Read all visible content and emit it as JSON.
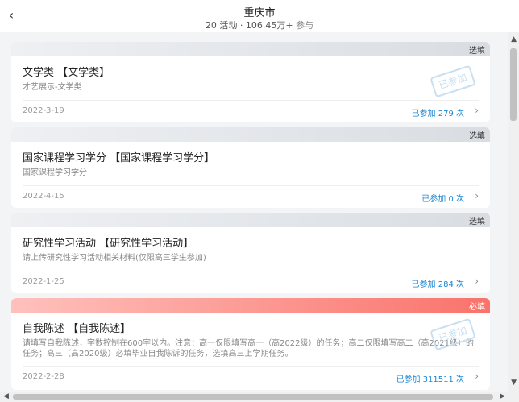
{
  "header": {
    "back_icon": "‹",
    "title": "重庆市",
    "activities": "20 活动",
    "separator": " · ",
    "participants": "106.45万+",
    "participants_suffix": " 参与"
  },
  "cards": [
    {
      "tag": "选填",
      "title": "文学类 【文学类】",
      "desc": "才艺展示-文学类",
      "date": "2022-3-19",
      "joined": "已参加 279 次",
      "stamp": "已参加",
      "required": false
    },
    {
      "tag": "选填",
      "title": "国家课程学习学分 【国家课程学习学分】",
      "desc": "国家课程学习学分",
      "date": "2022-4-15",
      "joined": "已参加 0 次",
      "required": false
    },
    {
      "tag": "选填",
      "title": "研究性学习活动 【研究性学习活动】",
      "desc": "请上传研究性学习活动相关材料(仅限高三学生参加)",
      "date": "2022-1-25",
      "joined": "已参加 284 次",
      "required": false
    },
    {
      "tag": "必填",
      "title": "自我陈述 【自我陈述】",
      "desc": "请填写自我陈述，字数控制在600字以内。注意：高一仅限填写高一（高2022级）的任务；高二仅限填写高二（高2021级）的任务；高三（高2020级）必填毕业自我陈诉的任务，选填高三上学期任务。",
      "date": "2022-2-28",
      "joined": "已参加 311511 次",
      "stamp": "已参加",
      "required": true
    }
  ],
  "icons": {
    "chevron_right": "›",
    "scroll_up": "▲",
    "scroll_down": "▼",
    "scroll_left": "◀",
    "scroll_right": "▶"
  },
  "colors": {
    "joined_text": "#1c86d1",
    "required_bar": "#f9736b",
    "optional_bar": "#d9dde2"
  }
}
